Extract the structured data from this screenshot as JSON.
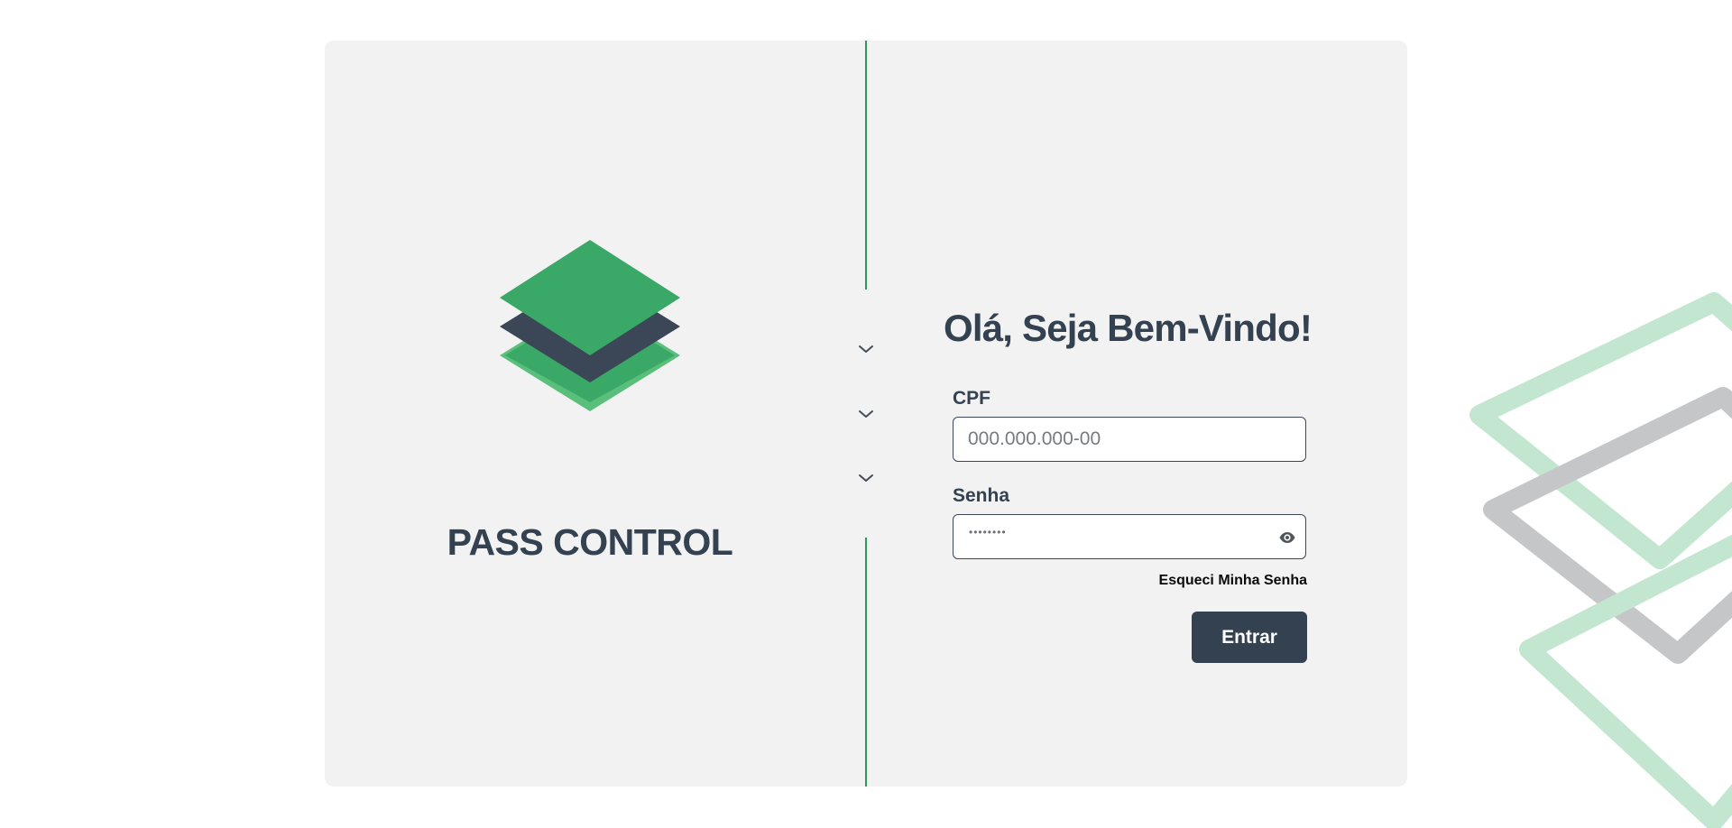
{
  "brand": {
    "name": "PASS CONTROL",
    "logo_icon": "stacked-layers-icon",
    "colors": {
      "green": "#3aa866",
      "light_green": "#5bbf7c",
      "dark": "#334150"
    }
  },
  "login": {
    "title": "Olá, Seja Bem-Vindo!",
    "cpf_label": "CPF",
    "cpf_placeholder": "000.000.000-00",
    "password_label": "Senha",
    "password_masked": "••••••••",
    "show_password_icon": "eye-icon",
    "forgot_password": "Esqueci Minha Senha",
    "submit_label": "Entrar"
  },
  "divider": {
    "chevron_icon": "chevron-down-icon",
    "chevron_count": 3,
    "color": "#2d9a5a"
  },
  "background": {
    "decoration_colors": [
      "#c3e6d0",
      "#c4c6c8"
    ]
  }
}
